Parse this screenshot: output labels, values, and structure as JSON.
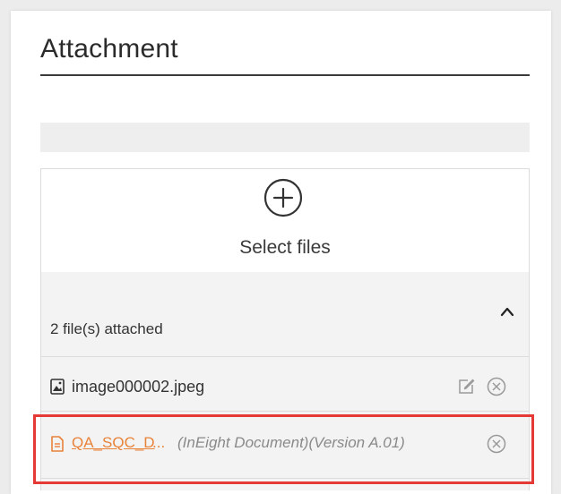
{
  "panel": {
    "title": "Attachment"
  },
  "upload": {
    "icon": "plus-circle-icon",
    "select_label": "Select files"
  },
  "attachments": {
    "count_label": "2 file(s) attached",
    "collapse_icon": "chevron-up-icon",
    "files": [
      {
        "icon": "image-file-icon",
        "name": "image000002.jpeg",
        "actions": [
          "edit-icon",
          "remove-icon"
        ]
      },
      {
        "icon": "document-file-icon",
        "name": "QA_SQC_D",
        "ellipsis": "...",
        "meta": "(InEight Document)(Version A.01)",
        "actions": [
          "remove-icon"
        ],
        "highlighted": true
      }
    ]
  },
  "colors": {
    "link": "#e8833a",
    "highlight": "#e53935",
    "meta_text": "#8a8a8a"
  }
}
